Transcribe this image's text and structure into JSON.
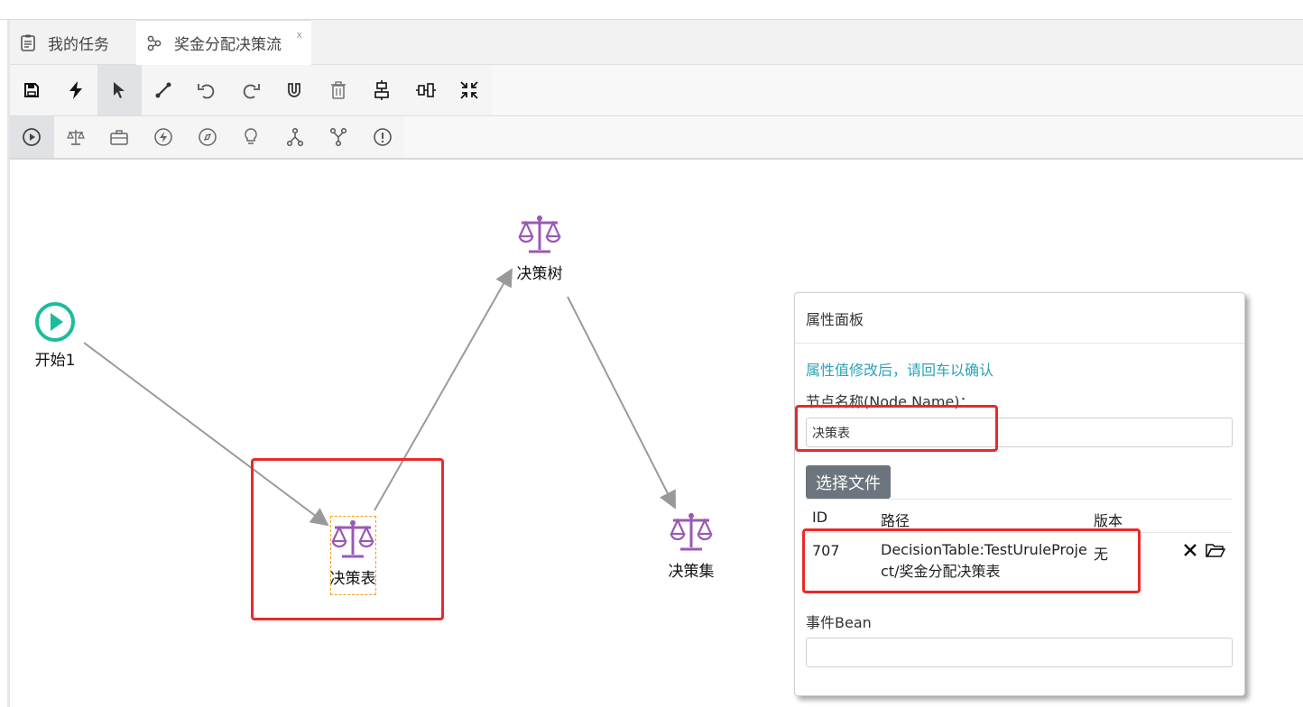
{
  "tabs": [
    {
      "label": "我的任务",
      "icon": "clipboard-icon"
    },
    {
      "label": "奖金分配决策流",
      "icon": "flow-icon",
      "close": "x"
    }
  ],
  "toolbar": {
    "buttons": [
      "save-icon",
      "bolt-icon",
      "pointer-icon",
      "connect-line-icon",
      "undo-icon",
      "redo-icon",
      "magnet-icon",
      "trash-icon",
      "align-vertical-icon",
      "align-horizontal-icon",
      "shrink-icon"
    ],
    "active": "pointer-icon"
  },
  "palette": {
    "buttons": [
      "start-node-icon",
      "scale-icon",
      "briefcase-icon",
      "bolt-circle-icon",
      "compass-icon",
      "bulb-icon",
      "fork-icon",
      "join-icon",
      "alert-icon"
    ]
  },
  "nodes": {
    "start": {
      "label": "开始1"
    },
    "decision_tree": {
      "label": "决策树"
    },
    "decision_table": {
      "label": "决策表"
    },
    "decision_set": {
      "label": "决策集"
    }
  },
  "panel": {
    "title": "属性面板",
    "hint": "属性值修改后，请回车以确认",
    "node_name_label": "节点名称(Node Name)：",
    "node_name_value": "决策表",
    "select_file_button": "选择文件",
    "table": {
      "headers": [
        "ID",
        "路径",
        "版本"
      ],
      "row": {
        "id": "707",
        "path": "DecisionTable:TestUruleProject/奖金分配决策表",
        "version": "无"
      }
    },
    "event_bean_label": "事件Bean",
    "event_bean_value": ""
  },
  "colors": {
    "accent_purple": "#9b59b6",
    "start_green": "#1abc9c",
    "hint_teal": "#2aa3b8",
    "highlight_red": "#e82a2a",
    "button_gray": "#6c757d"
  }
}
